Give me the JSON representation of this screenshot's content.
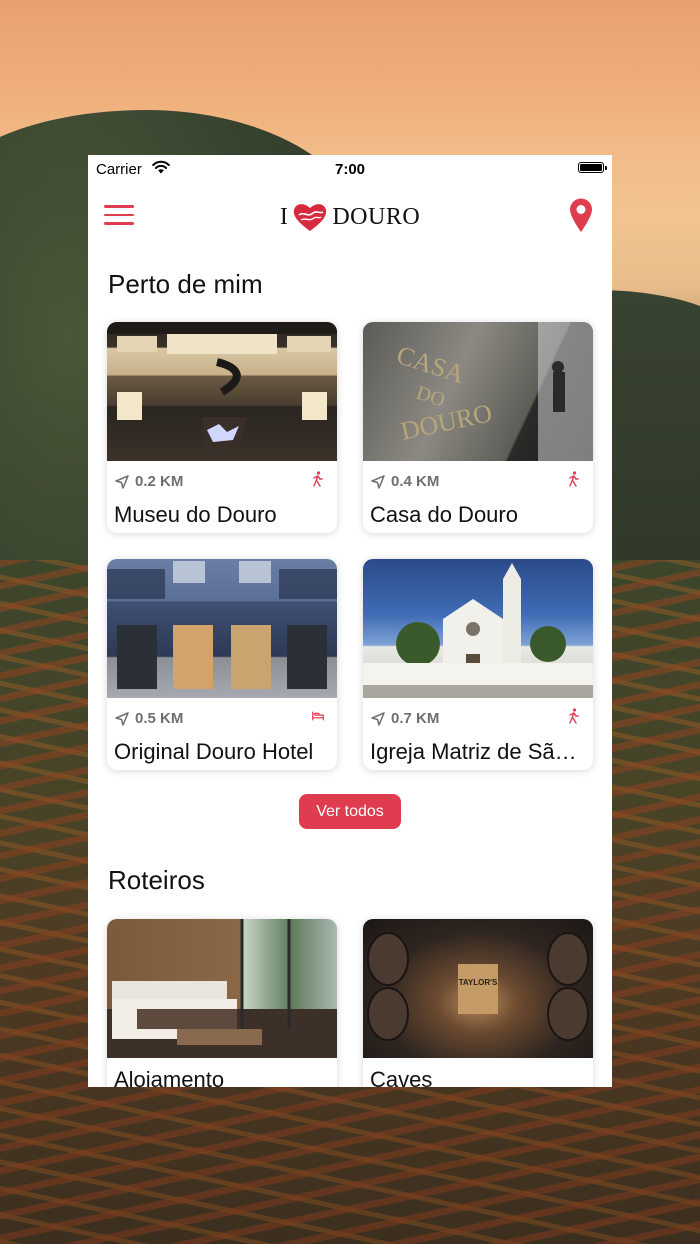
{
  "status_bar": {
    "carrier": "Carrier",
    "time": "7:00"
  },
  "header": {
    "logo_prefix": "I",
    "logo_suffix": "DOURO"
  },
  "sections": {
    "nearby": {
      "title": "Perto de mim",
      "cards": [
        {
          "distance": "0.2 KM",
          "name": "Museu do Douro",
          "type_icon": "walking-icon"
        },
        {
          "distance": "0.4 KM",
          "name": "Casa do Douro",
          "type_icon": "walking-icon"
        },
        {
          "distance": "0.5 KM",
          "name": "Original Douro Hotel",
          "type_icon": "bed-icon"
        },
        {
          "distance": "0.7 KM",
          "name": "Igreja Matriz de São Pedro",
          "type_icon": "walking-icon"
        }
      ],
      "see_all": "Ver todos"
    },
    "routes": {
      "title": "Roteiros",
      "cards": [
        {
          "name": "Alojamento"
        },
        {
          "name": "Caves"
        }
      ]
    }
  },
  "colors": {
    "accent": "#e03c4f",
    "distance_text": "#6e6e73"
  }
}
